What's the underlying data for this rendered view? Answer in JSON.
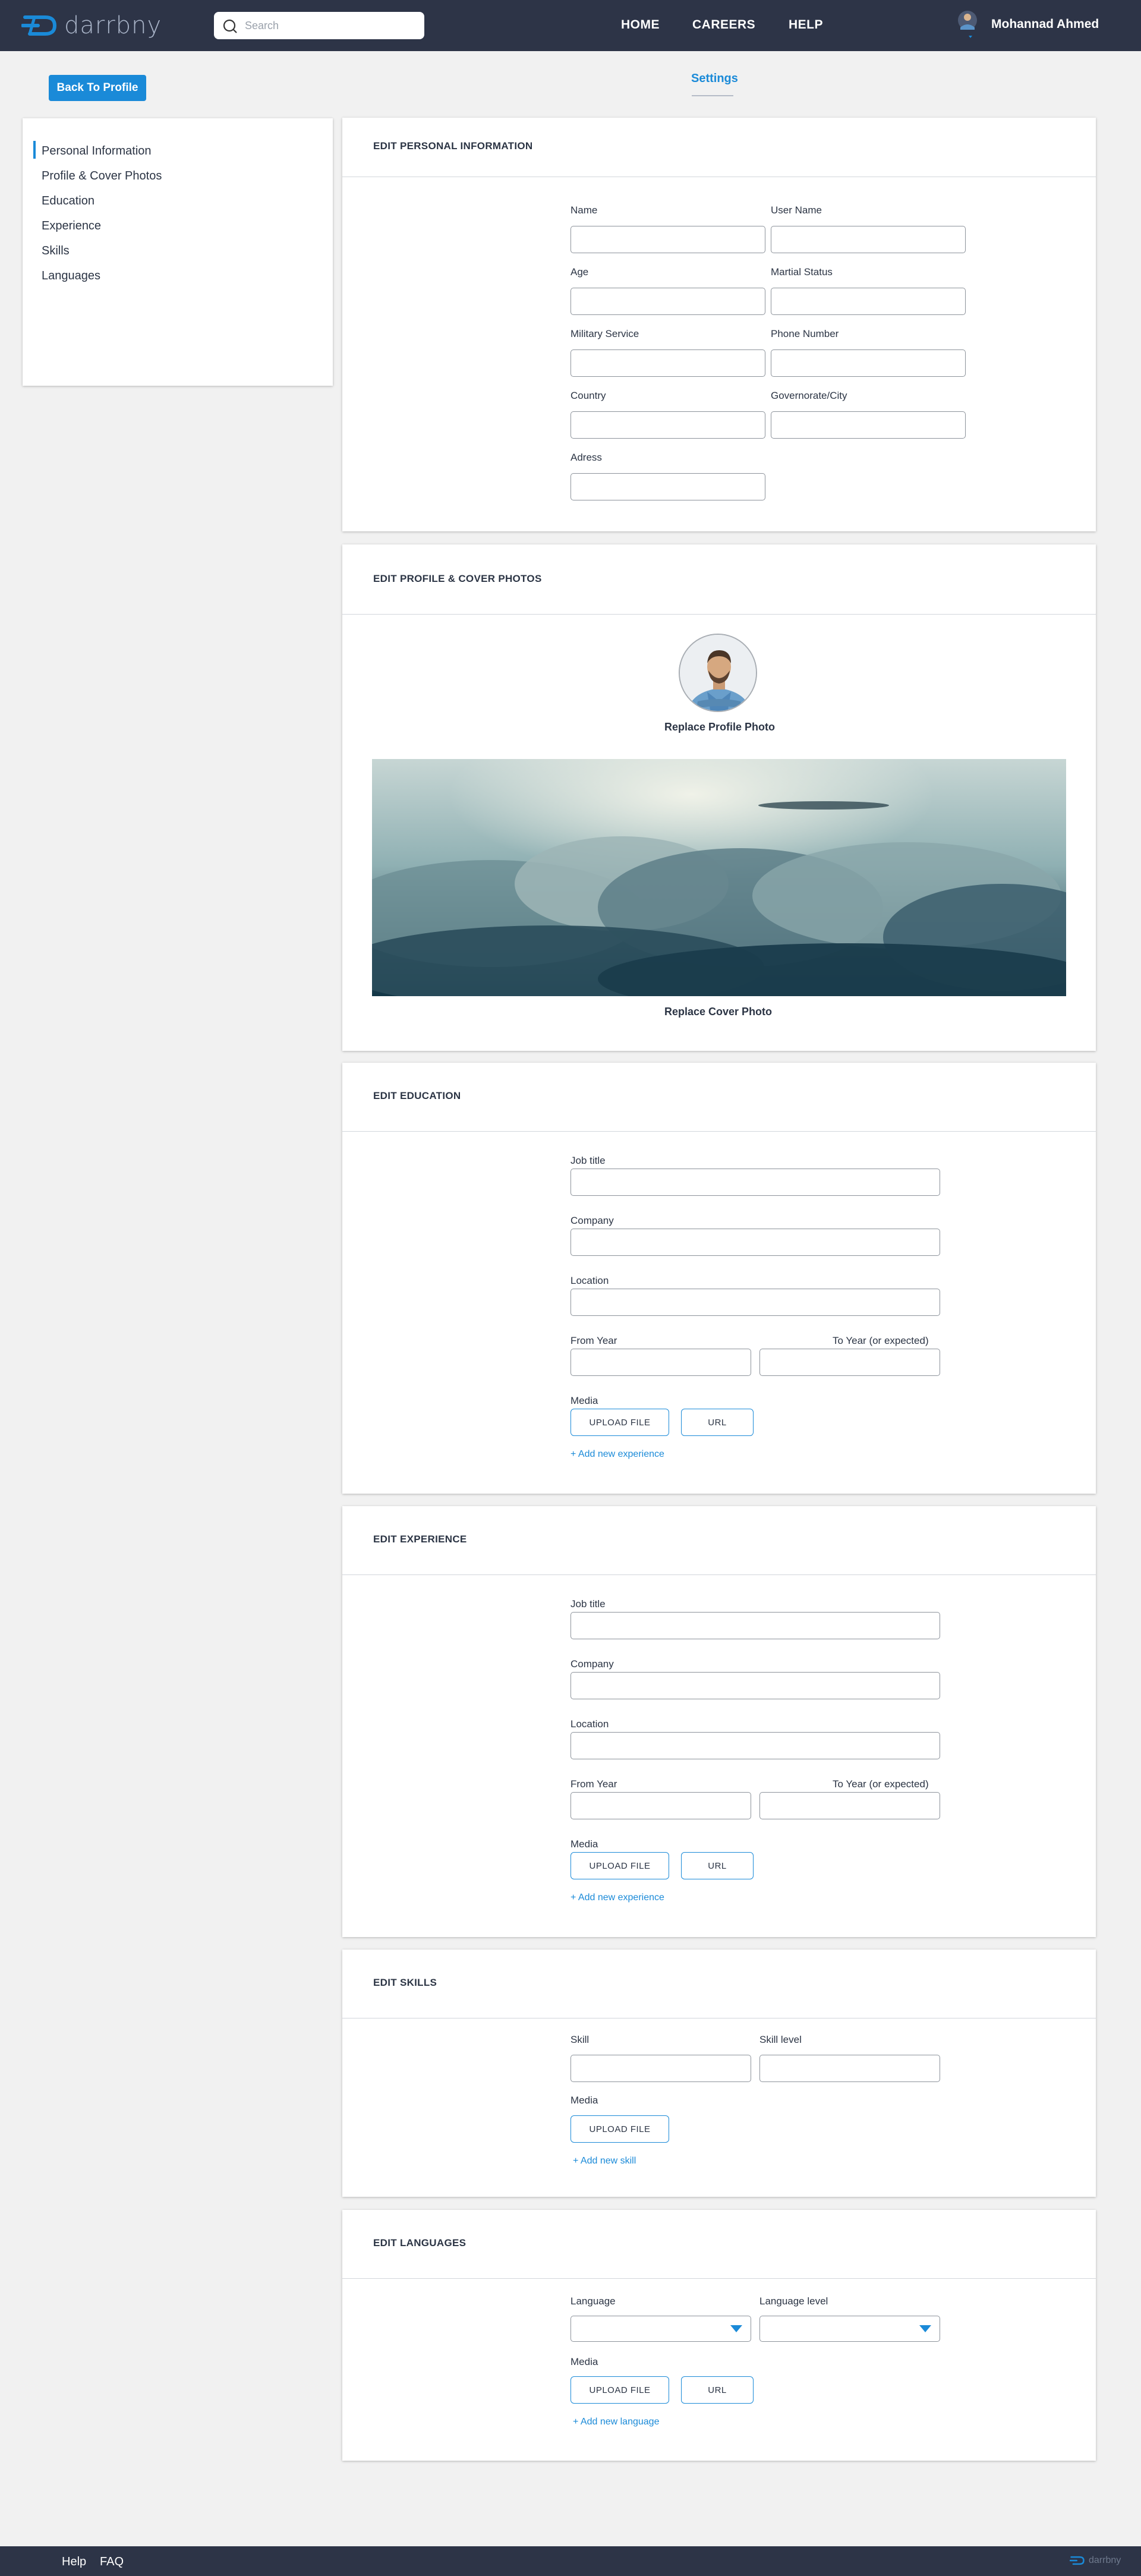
{
  "brand": {
    "name": "darrbny"
  },
  "search": {
    "placeholder": "Search"
  },
  "nav": {
    "home": "HOME",
    "careers": "CAREERS",
    "help": "HELP"
  },
  "user": {
    "name": "Mohannad Ahmed"
  },
  "back_button": "Back To Profile",
  "settings_title": "Settings",
  "sidebar": {
    "items": [
      {
        "label": "Personal Information",
        "active": true
      },
      {
        "label": "Profile & Cover Photos"
      },
      {
        "label": "Education"
      },
      {
        "label": "Experience"
      },
      {
        "label": "Skills"
      },
      {
        "label": "Languages"
      }
    ]
  },
  "personal": {
    "title": "EDIT PERSONAL INFORMATION",
    "labels": {
      "name": "Name",
      "username": "User Name",
      "age": "Age",
      "martial": "Martial Status",
      "military": "Military Service",
      "phone": "Phone Number",
      "country": "Country",
      "city": "Governorate/City",
      "address": "Adress"
    }
  },
  "photos": {
    "title": "EDIT PROFILE & COVER PHOTOS",
    "replace_profile": "Replace Profile Photo",
    "replace_cover": "Replace Cover Photo"
  },
  "education": {
    "title": "EDIT EDUCATION",
    "labels": {
      "job": "Job title",
      "company": "Company",
      "location": "Location",
      "from": "From Year",
      "to": "To Year (or expected)",
      "media": "Media"
    },
    "upload": "UPLOAD FILE",
    "url": "URL",
    "add": "+ Add new experience"
  },
  "experience": {
    "title": "EDIT EXPERIENCE",
    "labels": {
      "job": "Job title",
      "company": "Company",
      "location": "Location",
      "from": "From Year",
      "to": "To Year (or expected)",
      "media": "Media"
    },
    "upload": "UPLOAD FILE",
    "url": "URL",
    "add": "+ Add new experience"
  },
  "skills": {
    "title": "EDIT SKILLS",
    "labels": {
      "skill": "Skill",
      "level": "Skill level",
      "media": "Media"
    },
    "upload": "UPLOAD FILE",
    "add": "+ Add new skill"
  },
  "languages": {
    "title": "EDIT LANGUAGES",
    "labels": {
      "language": "Language",
      "level": "Language level",
      "media": "Media"
    },
    "upload": "UPLOAD FILE",
    "url": "URL",
    "add": "+ Add new language"
  },
  "footer": {
    "help": "Help",
    "faq": "FAQ",
    "brand": "darrbny"
  },
  "colors": {
    "nav_bg": "#2d3447",
    "accent": "#1a8ad8",
    "page_bg": "#f1f1f1"
  }
}
